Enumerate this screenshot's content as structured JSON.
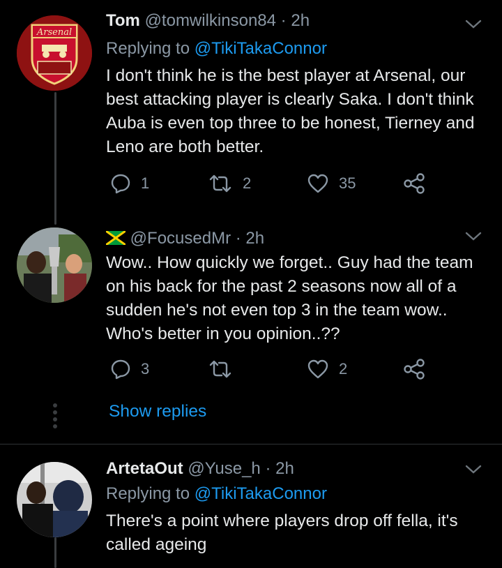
{
  "tweets": [
    {
      "display_name": "Tom",
      "handle": "@tomwilkinson84",
      "separator": "·",
      "time": "2h",
      "replying_label": "Replying to ",
      "replying_to": "@TikiTakaConnor",
      "lines": [
        "I don't think he is the best player at Arsenal, our",
        "best attacking player is clearly Saka. I don't think",
        "Auba is even top three to be honest, Tierney and",
        "Leno are both better."
      ],
      "avatar_text": "Arsenal",
      "replies": "1",
      "retweets": "2",
      "likes": "35"
    },
    {
      "display_name": "",
      "handle": "@FocusedMr",
      "separator": "·",
      "time": "2h",
      "lines": [
        "Wow.. How quickly we forget.. Guy had the team",
        "on his back for the past 2 seasons now all of a",
        "sudden he's not even top 3 in the team wow..",
        "Who's better in you opinion..??"
      ],
      "replies": "3",
      "retweets": "",
      "likes": "2"
    },
    {
      "display_name": "ArtetaOut",
      "handle": "@Yuse_h",
      "separator": "·",
      "time": "2h",
      "replying_label": "Replying to ",
      "replying_to": "@TikiTakaConnor",
      "lines": [
        "There's a point where players drop off fella, it's",
        "called ageing"
      ]
    }
  ],
  "show_replies": "Show replies",
  "colors": {
    "background": "#000000",
    "accent": "#1d9bf0",
    "muted": "#8b98a5",
    "text": "#e7e9ea"
  },
  "icons": [
    "chevron-down-icon",
    "reply-icon",
    "retweet-icon",
    "like-icon",
    "share-icon",
    "jamaica-flag-icon"
  ]
}
